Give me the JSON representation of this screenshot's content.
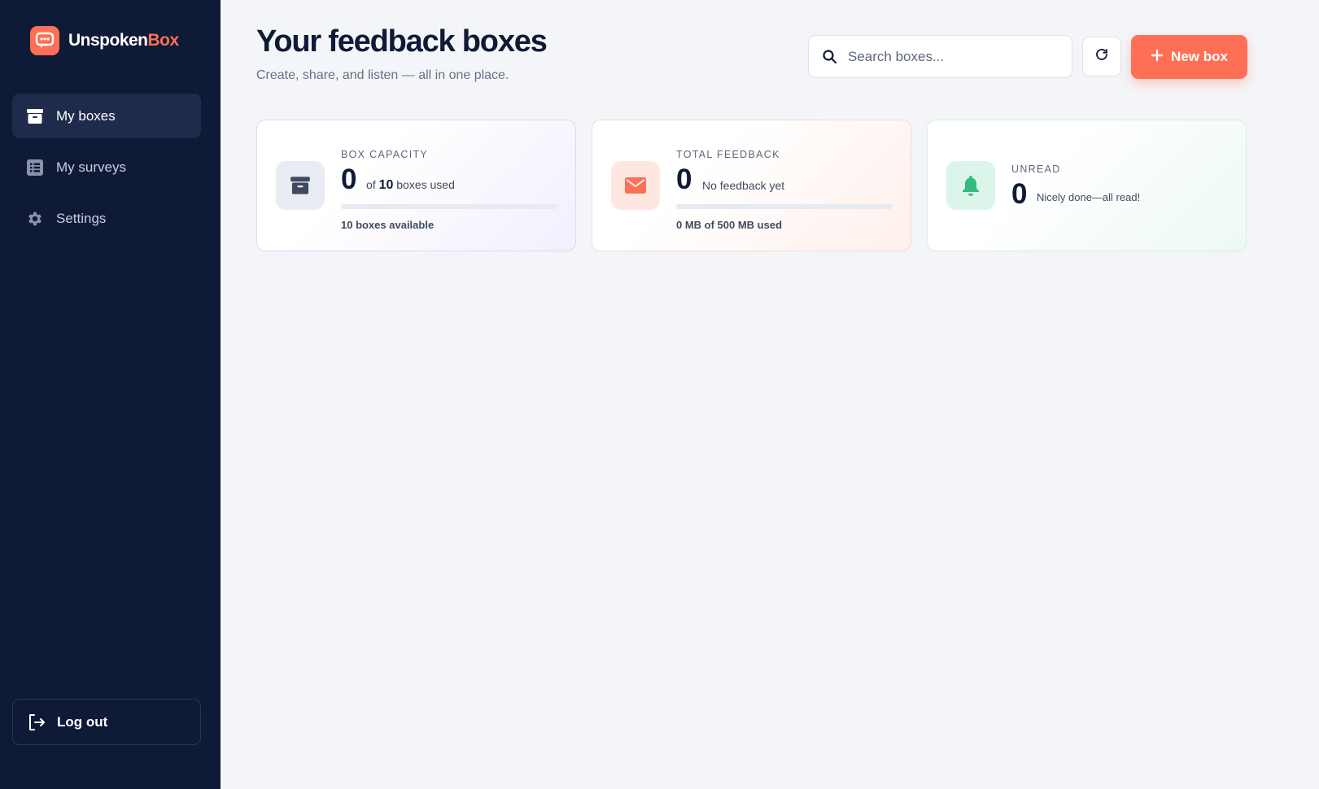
{
  "brand": {
    "name_part1": "Unspoken",
    "name_part2": "Box",
    "accent_color": "#ff6f55"
  },
  "sidebar": {
    "items": [
      {
        "label": "My boxes",
        "icon": "archive-icon",
        "active": true
      },
      {
        "label": "My surveys",
        "icon": "list-icon",
        "active": false
      },
      {
        "label": "Settings",
        "icon": "gear-icon",
        "active": false
      }
    ],
    "logout_label": "Log out"
  },
  "header": {
    "title": "Your feedback boxes",
    "subtitle": "Create, share, and listen — all in one place.",
    "search_placeholder": "Search boxes...",
    "search_value": "",
    "new_box_label": "New box"
  },
  "stats": {
    "capacity": {
      "label": "BOX CAPACITY",
      "value": "0",
      "of_text": "of",
      "limit": "10",
      "suffix": "boxes used",
      "footer": "10 boxes available",
      "progress": 0,
      "icon": "archive-icon"
    },
    "feedback": {
      "label": "TOTAL FEEDBACK",
      "value": "0",
      "desc": "No feedback yet",
      "footer": "0 MB of 500 MB used",
      "progress": 0,
      "icon": "mail-icon"
    },
    "unread": {
      "label": "UNREAD",
      "value": "0",
      "desc": "Nicely done—all read!",
      "icon": "bell-icon"
    }
  },
  "colors": {
    "sidebar_bg": "#0f1a36",
    "accent": "#ff6f55",
    "success": "#34b982",
    "page_bg": "#f4f5f8"
  }
}
